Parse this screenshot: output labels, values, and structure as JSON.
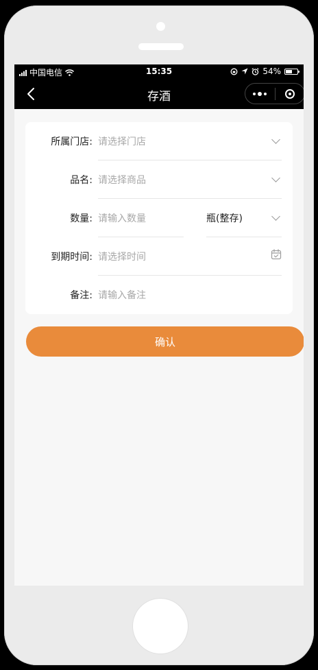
{
  "status_bar": {
    "carrier": "中国电信",
    "time": "15:35",
    "battery": "54%",
    "battery_level": 0.54
  },
  "nav": {
    "title": "存酒"
  },
  "form": {
    "store": {
      "label": "所属门店:",
      "placeholder": "请选择门店"
    },
    "product": {
      "label": "品名:",
      "placeholder": "请选择商品"
    },
    "quantity": {
      "label": "数量:",
      "placeholder": "请输入数量",
      "unit": "瓶(整存)"
    },
    "expiry": {
      "label": "到期时间:",
      "placeholder": "请选择时间"
    },
    "remark": {
      "label": "备注:",
      "placeholder": "请输入备注"
    }
  },
  "confirm_label": "确认",
  "colors": {
    "accent": "#e98b3b",
    "nav_background": "#000000",
    "page_background": "#f7f7f7"
  },
  "icons": {
    "back": "chevron-left-icon",
    "more": "more-dots-icon",
    "close": "target-circle-icon",
    "dropdown": "chevron-down-icon",
    "calendar": "calendar-icon"
  }
}
